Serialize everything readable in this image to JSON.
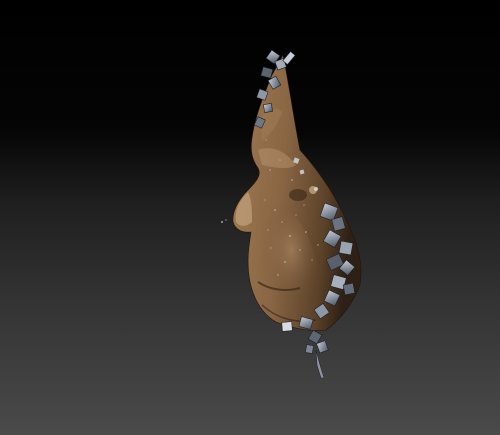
{
  "viewport": {
    "background_top": "#000000",
    "background_bottom": "#4a4a4a",
    "model_base_color": "#7a5a3c",
    "model_highlight_color": "#b08a62",
    "model_shadow_color": "#2a1d12",
    "fragment_color": "#8a96a8"
  }
}
